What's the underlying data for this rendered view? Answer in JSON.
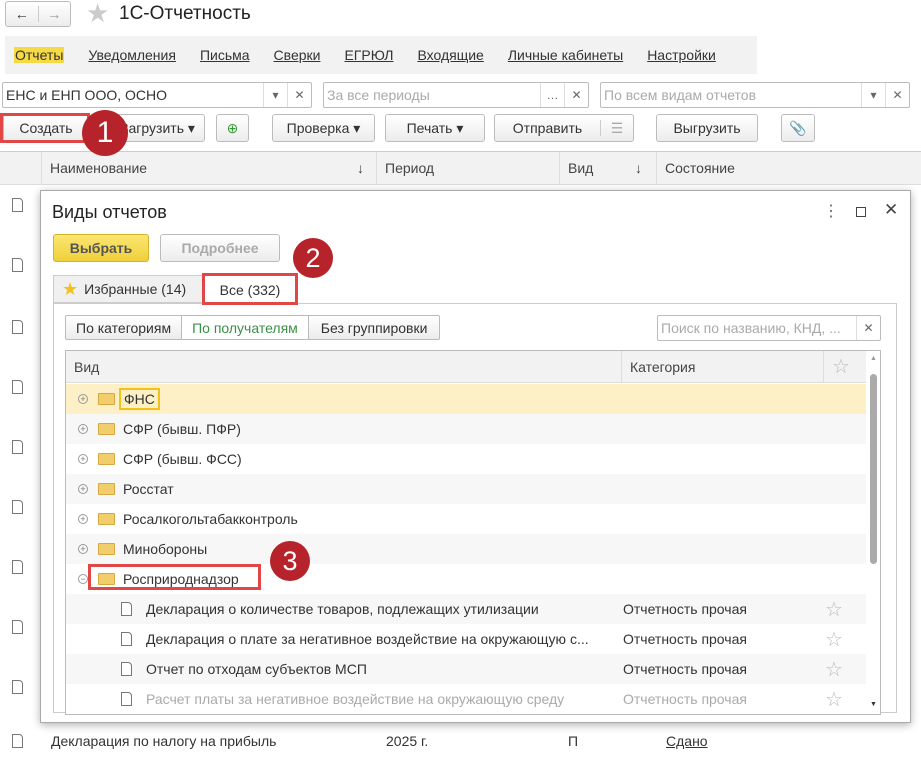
{
  "app": {
    "title": "1С-Отчетность",
    "back": "←",
    "forward": "→"
  },
  "menu": [
    "Отчеты",
    "Уведомления",
    "Письма",
    "Сверки",
    "ЕГРЮЛ",
    "Входящие",
    "Личные кабинеты",
    "Настройки"
  ],
  "filters": {
    "organization": "ЕНС и ЕНП ООО, ОСНО",
    "period_placeholder": "За все периоды",
    "kind_placeholder": "По всем видам отчетов"
  },
  "toolbar": {
    "create": "Создать",
    "load": "Загрузить",
    "check": "Проверка",
    "print": "Печать",
    "send": "Отправить",
    "export": "Выгрузить"
  },
  "table": {
    "columns": [
      "Наименование",
      "Период",
      "Вид",
      "Состояние"
    ],
    "visible_row": {
      "name": "Декларация по налогу на прибыль",
      "period": "2025 г.",
      "kind": "П",
      "status": "Сдано"
    }
  },
  "dialog": {
    "title": "Виды отчетов",
    "select": "Выбрать",
    "details": "Подробнее",
    "tabs": [
      "Избранные (14)",
      "Все (332)"
    ],
    "grouping": [
      "По категориям",
      "По получателям",
      "Без группировки"
    ],
    "search_placeholder": "Поиск по названию, КНД, ...",
    "columns": [
      "Вид",
      "Категория"
    ],
    "groups": [
      "ФНС",
      "СФР (бывш. ПФР)",
      "СФР (бывш. ФСС)",
      "Росстат",
      "Росалкогольтабакконтроль",
      "Минобороны",
      "Росприроднадзор"
    ],
    "items": [
      {
        "name": "Декларация о количестве товаров, подлежащих утилизации",
        "category": "Отчетность прочая"
      },
      {
        "name": "Декларация о плате за негативное воздействие на окружающую с...",
        "category": "Отчетность прочая"
      },
      {
        "name": "Отчет по отходам субъектов МСП",
        "category": "Отчетность прочая"
      },
      {
        "name": "Расчет платы за негативное воздействие на окружающую среду",
        "category": "Отчетность прочая"
      }
    ]
  },
  "annotations": [
    "1",
    "2",
    "3"
  ],
  "colors": {
    "accent": "#f5d945",
    "badge": "#b7232a",
    "highlight": "#fdf0c6",
    "green": "#3c8f46"
  }
}
